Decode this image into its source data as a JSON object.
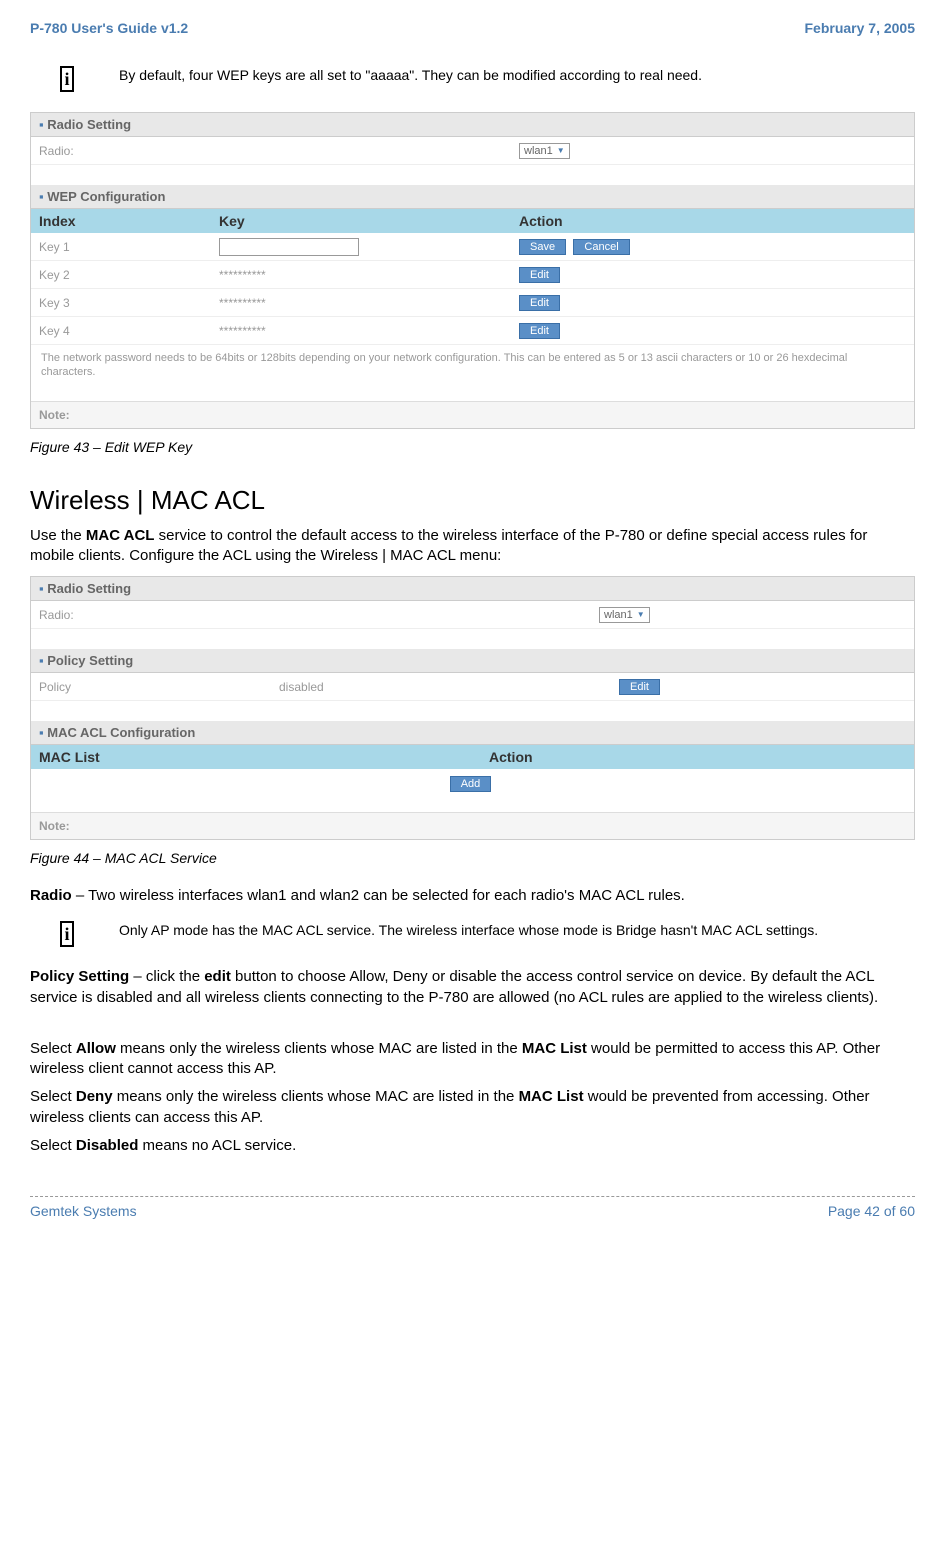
{
  "header": {
    "left": "P-780 User's Guide v1.2",
    "right": "February 7, 2005"
  },
  "note1": "By default, four WEP keys are all set to \"aaaaa\". They can be modified according to real need.",
  "wep_panel": {
    "radio_section": "Radio Setting",
    "radio_label": "Radio:",
    "radio_value": "wlan1",
    "wep_section": "WEP Configuration",
    "headers": {
      "index": "Index",
      "key": "Key",
      "action": "Action"
    },
    "rows": [
      {
        "label": "Key 1",
        "value": "",
        "buttons": [
          "Save",
          "Cancel"
        ]
      },
      {
        "label": "Key 2",
        "value": "**********",
        "buttons": [
          "Edit"
        ]
      },
      {
        "label": "Key 3",
        "value": "**********",
        "buttons": [
          "Edit"
        ]
      },
      {
        "label": "Key 4",
        "value": "**********",
        "buttons": [
          "Edit"
        ]
      }
    ],
    "footnote": "The network password needs to be 64bits or 128bits depending on your network configuration. This can be entered as 5 or 13 ascii characters or 10 or 26 hexdecimal characters.",
    "note_label": "Note:"
  },
  "fig43": "Figure 43 – Edit WEP Key",
  "heading": "Wireless | MAC ACL",
  "intro": "Use the MAC ACL service to control the default access to the wireless interface of the P-780 or define special access rules for mobile clients. Configure the ACL using the Wireless | MAC ACL menu:",
  "acl_panel": {
    "radio_section": "Radio Setting",
    "radio_label": "Radio:",
    "radio_value": "wlan1",
    "policy_section": "Policy Setting",
    "policy_label": "Policy",
    "policy_value": "disabled",
    "policy_btn": "Edit",
    "macl_section": "MAC ACL Configuration",
    "macl_headers": {
      "list": "MAC List",
      "action": "Action"
    },
    "add_btn": "Add",
    "note_label": "Note:"
  },
  "fig44": "Figure 44 – MAC ACL Service",
  "radio_text": "Radio – Two wireless interfaces wlan1 and wlan2 can be selected for each radio's MAC ACL rules.",
  "note2": "Only AP mode has the MAC ACL service.  The wireless interface whose mode is Bridge hasn't MAC ACL settings.",
  "policy_text": "Policy Setting – click the edit button to choose Allow, Deny or disable the access control service on device. By default the ACL service is disabled and all wireless clients connecting to the P-780 are allowed (no ACL rules are applied to the wireless clients).",
  "allow_text": "Select Allow means only the wireless clients whose MAC are listed in the MAC List would be permitted to access this AP. Other wireless client cannot access this AP.",
  "deny_text": "Select Deny means only the wireless clients whose MAC are listed in the MAC List would be prevented from accessing. Other wireless clients can access this AP.",
  "disabled_text": "Select Disabled means no ACL service.",
  "footer": {
    "left": "Gemtek Systems",
    "right": "Page 42 of 60"
  }
}
